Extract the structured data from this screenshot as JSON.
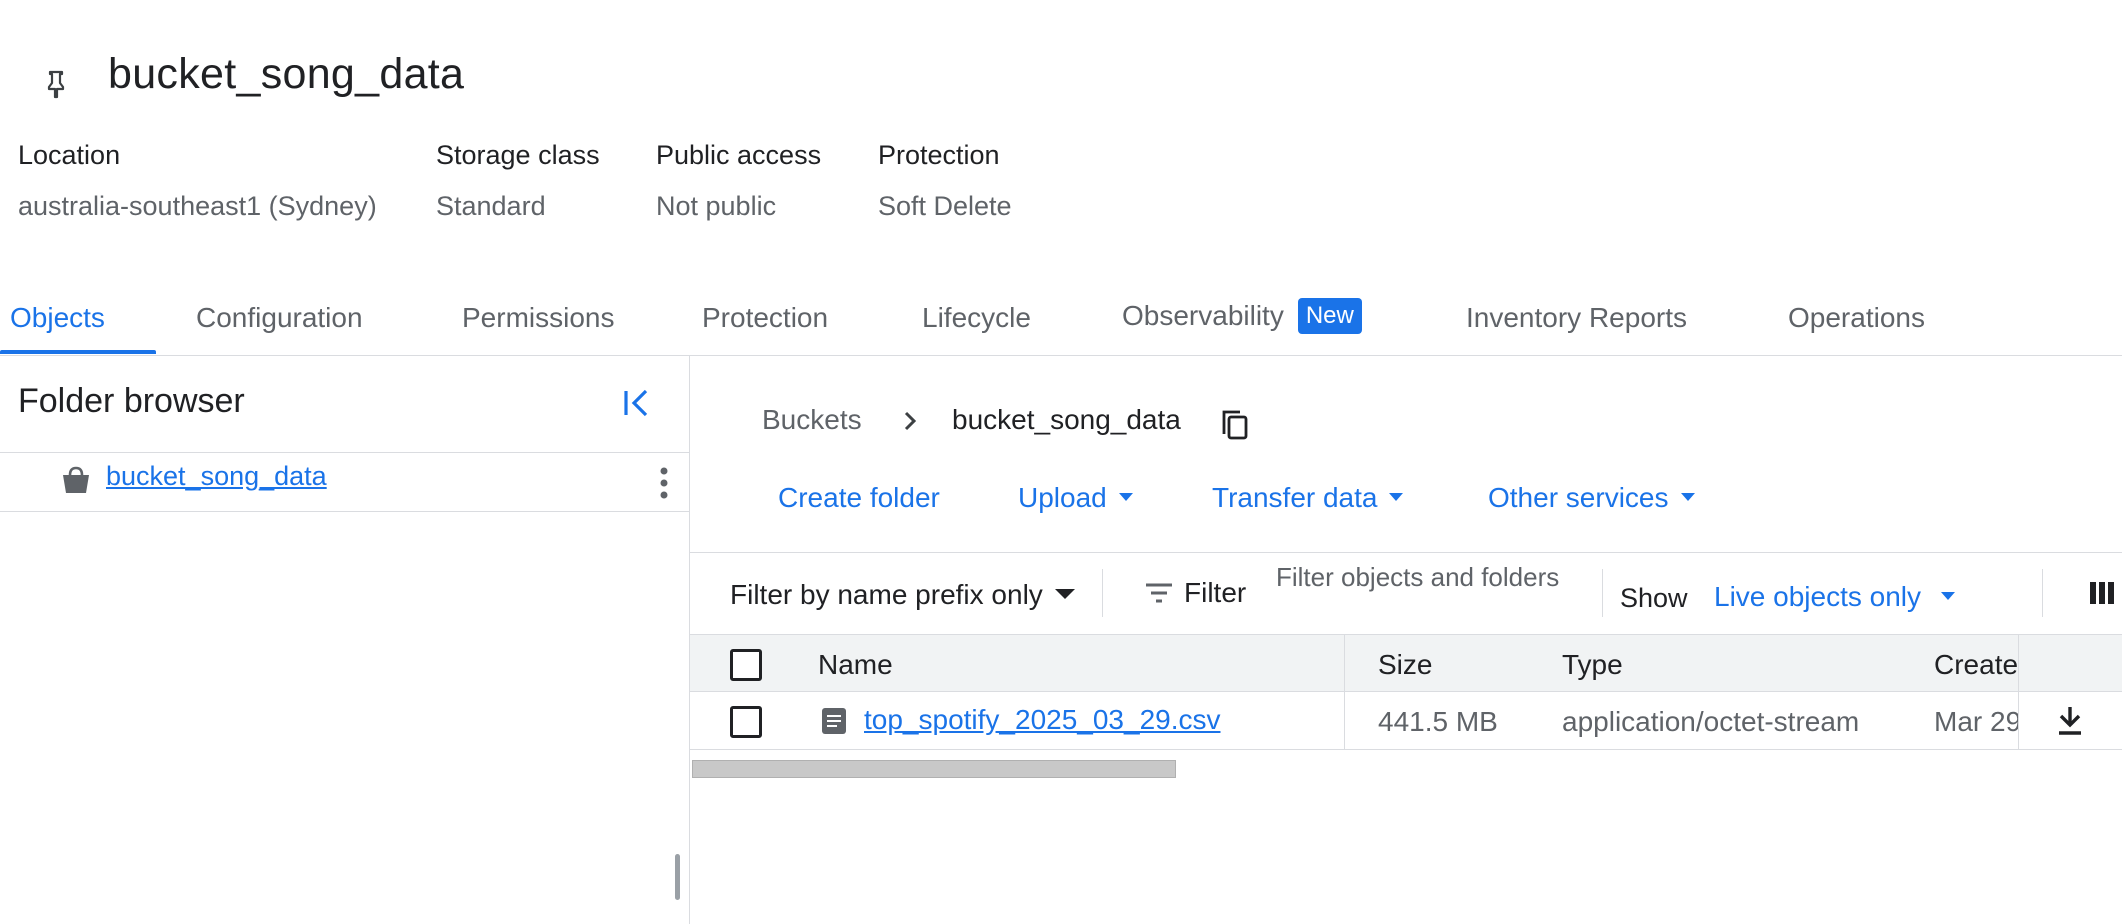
{
  "bucket": {
    "title": "bucket_song_data"
  },
  "meta": {
    "location": {
      "label": "Location",
      "value": "australia-southeast1 (Sydney)"
    },
    "storage_class": {
      "label": "Storage class",
      "value": "Standard"
    },
    "public_access": {
      "label": "Public access",
      "value": "Not public"
    },
    "protection": {
      "label": "Protection",
      "value": "Soft Delete"
    }
  },
  "tabs": [
    {
      "label": "Objects",
      "active": true
    },
    {
      "label": "Configuration"
    },
    {
      "label": "Permissions"
    },
    {
      "label": "Protection"
    },
    {
      "label": "Lifecycle"
    },
    {
      "label": "Observability",
      "badge": "New"
    },
    {
      "label": "Inventory Reports"
    },
    {
      "label": "Operations"
    }
  ],
  "sidebar": {
    "title": "Folder browser",
    "items": [
      {
        "label": "bucket_song_data"
      }
    ]
  },
  "breadcrumb": {
    "root": "Buckets",
    "current": "bucket_song_data"
  },
  "actions": {
    "create_folder": "Create folder",
    "upload": "Upload",
    "transfer_data": "Transfer data",
    "other_services": "Other services"
  },
  "filter": {
    "prefix_mode": "Filter by name prefix only",
    "filter_label": "Filter",
    "placeholder": "Filter objects and folders",
    "show_label": "Show",
    "show_value": "Live objects only"
  },
  "table": {
    "headers": {
      "name": "Name",
      "size": "Size",
      "type": "Type",
      "created": "Create"
    },
    "rows": [
      {
        "name": "top_spotify_2025_03_29.csv",
        "size": "441.5 MB",
        "type": "application/octet-stream",
        "created": "Mar 29"
      }
    ]
  },
  "colors": {
    "accent": "#1a73e8",
    "text": "#202124",
    "muted": "#5f6368",
    "divider": "#dadce0"
  }
}
